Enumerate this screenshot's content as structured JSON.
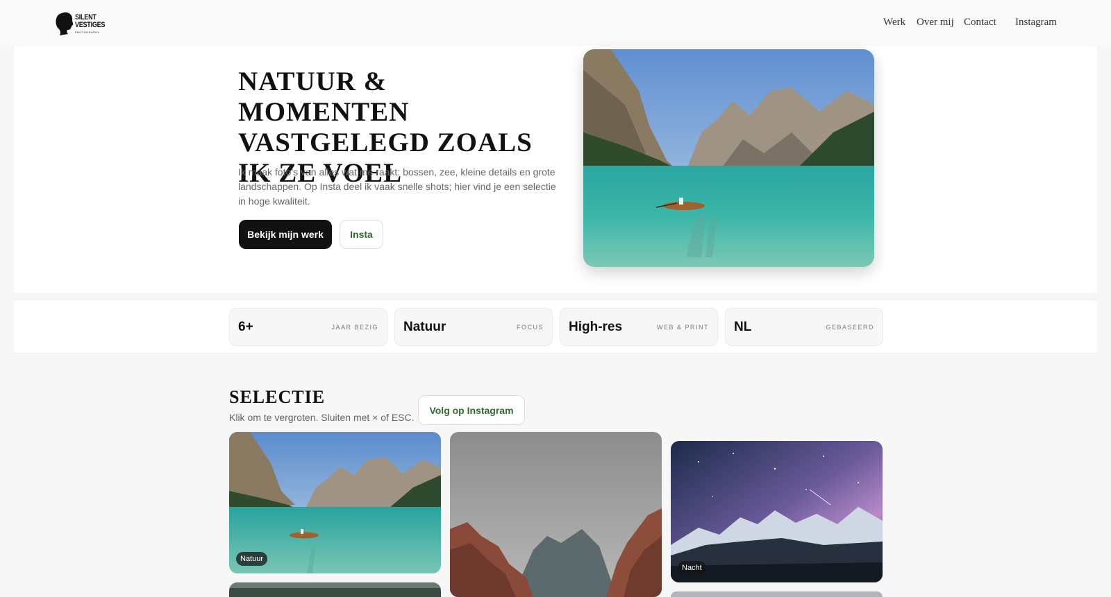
{
  "brand": {
    "logo_line1": "SILENT",
    "logo_line2": "VESTIGES",
    "logo_line3": "PHOTOGRAPHY"
  },
  "nav": {
    "items": [
      {
        "label": "Werk"
      },
      {
        "label": "Over mij"
      },
      {
        "label": "Contact"
      },
      {
        "label": "Instagram"
      }
    ]
  },
  "hero": {
    "title": "NATUUR & MOMENTEN VASTGELEGD ZOALS IK ZE VOEL",
    "text": "Ik maak foto’s van alles wat me raakt: bossen, zee, kleine details en grote landschappen. Op Insta deel ik vaak snelle shots; hier vind je een selectie in hoge kwaliteit.",
    "primary_button": "Bekijk mijn werk",
    "secondary_button": "Insta"
  },
  "stats": [
    {
      "value": "6+",
      "label": "JAAR BEZIG"
    },
    {
      "value": "Natuur",
      "label": "FOCUS"
    },
    {
      "value": "High-res",
      "label": "WEB & PRINT"
    },
    {
      "value": "NL",
      "label": "GEBASEERD"
    }
  ],
  "selection": {
    "title": "SELECTIE",
    "subtitle": "Klik om te vergroten. Sluiten met × of ESC.",
    "follow_button": "Volg op Instagram",
    "tags": {
      "lake": "Natuur",
      "night": "Nacht"
    }
  },
  "colors": {
    "accent_green": "#2f6b2f",
    "dark_button": "#111111"
  }
}
